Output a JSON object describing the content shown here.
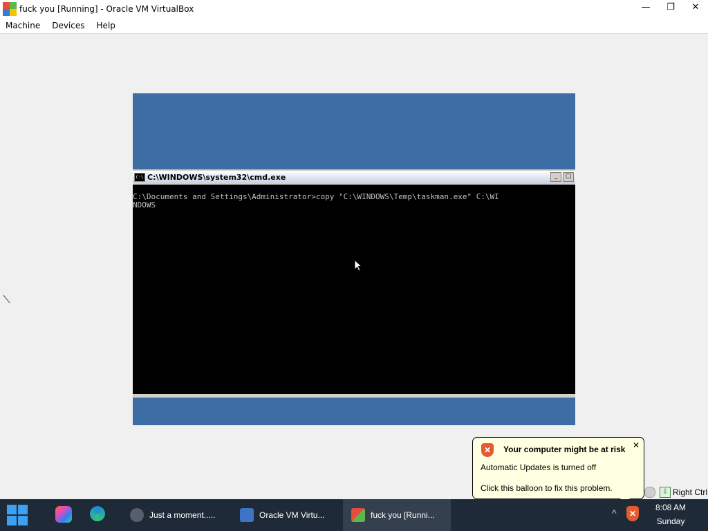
{
  "window": {
    "title": "fuck you [Running] - Oracle VM VirtualBox",
    "controls": {
      "minimize": "—",
      "maximize": "❐",
      "close": "✕"
    }
  },
  "menubar": {
    "items": [
      "Machine",
      "Devices",
      "Help"
    ]
  },
  "vm": {
    "cmd": {
      "title": "C:\\WINDOWS\\system32\\cmd.exe",
      "icon_text": "C:\\",
      "lines": [
        "C:\\Documents and Settings\\Administrator>copy \"C:\\WINDOWS\\Temp\\taskman.exe\" C:\\WI",
        "NDOWS"
      ],
      "btn_minimize": "_",
      "btn_maximize": "□"
    }
  },
  "balloon": {
    "title": "Your computer might be at risk",
    "line1": "Automatic Updates is turned off",
    "line2": "Click this balloon to fix this problem.",
    "close": "✕",
    "shield_glyph": "✕"
  },
  "status": {
    "host_key": "Right Ctrl",
    "kb_glyph": "⇩"
  },
  "taskbar": {
    "apps": [
      {
        "label": "Just a moment.....",
        "icon": "globe-icon"
      },
      {
        "label": "Oracle VM Virtu...",
        "icon": "virtualbox-icon"
      },
      {
        "label": "fuck you [Runni...",
        "icon": "vm-xp-icon"
      }
    ],
    "tray_chevron": "^",
    "clock_time": "8:08 AM",
    "clock_day": "Sunday"
  },
  "colors": {
    "vm_desktop": "#3c6ea5",
    "taskbar": "#1f2a38",
    "balloon_bg": "#ffffe1",
    "shield": "#e35b2e"
  }
}
